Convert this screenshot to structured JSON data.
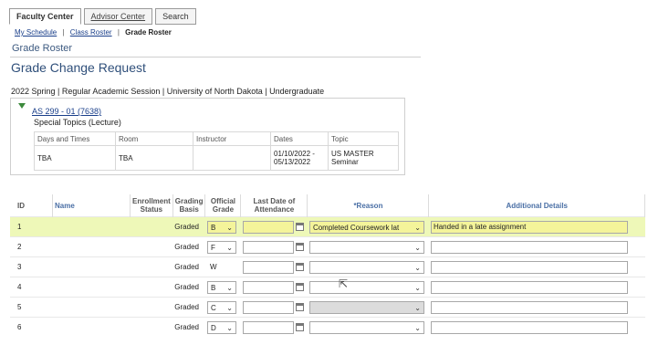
{
  "tabs": [
    "Faculty Center",
    "Advisor Center",
    "Search"
  ],
  "breadcrumbs": {
    "my_schedule": "My Schedule",
    "sep": "|",
    "class_roster": "Class Roster",
    "current": "Grade Roster"
  },
  "page_title": "Grade Roster",
  "heading": "Grade Change Request",
  "term_line": "2022 Spring | Regular Academic Session | University of North Dakota | Undergraduate",
  "class": {
    "link": "AS 299 - 01 (7638)",
    "title": "Special Topics (Lecture)",
    "headers": [
      "Days and Times",
      "Room",
      "Instructor",
      "Dates",
      "Topic"
    ],
    "row": {
      "days": "TBA",
      "room": "TBA",
      "instructor": "",
      "dates": "01/10/2022 - 05/13/2022",
      "topic": "US MASTER Seminar"
    }
  },
  "grid": {
    "headers": {
      "id": "ID",
      "name": "Name",
      "enroll": "Enrollment Status",
      "basis": "Grading Basis",
      "official": "Official Grade",
      "last_date": "Last Date of Attendance",
      "reason": "*Reason",
      "details": "Additional Details"
    },
    "rows": [
      {
        "id": "1",
        "basis": "Graded",
        "grade": "B",
        "reason": "Completed Coursework lat",
        "details": "Handed in a late assignment"
      },
      {
        "id": "2",
        "basis": "Graded",
        "grade": "F",
        "reason": "",
        "details": ""
      },
      {
        "id": "3",
        "basis": "Graded",
        "grade": "W",
        "reason": "",
        "details": ""
      },
      {
        "id": "4",
        "basis": "Graded",
        "grade": "B",
        "reason": "",
        "details": ""
      },
      {
        "id": "5",
        "basis": "Graded",
        "grade": "C",
        "reason": "",
        "details": ""
      },
      {
        "id": "6",
        "basis": "Graded",
        "grade": "D",
        "reason": "",
        "details": ""
      }
    ]
  },
  "colors": {
    "highlight": "#eef8b8",
    "link": "#1a3f8a",
    "heading": "#2f4f7a"
  }
}
